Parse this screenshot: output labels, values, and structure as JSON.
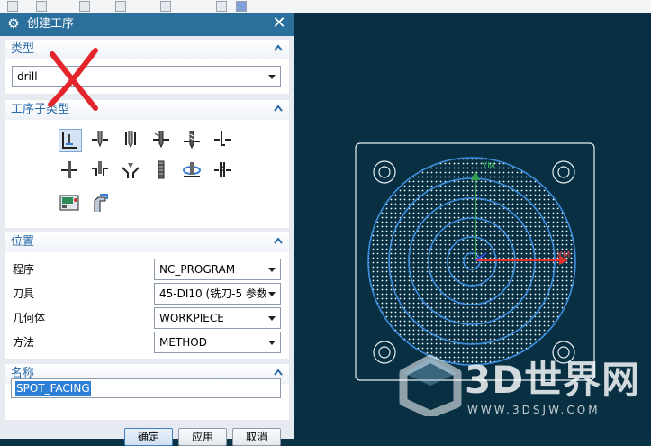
{
  "dialog": {
    "title": "创建工序",
    "close_glyph": "✕",
    "gear_glyph": "⚙"
  },
  "sections": {
    "type": {
      "label": "类型",
      "value": "drill"
    },
    "subtype": {
      "label": "工序子类型",
      "icons": [
        "spot-facing-icon",
        "spot-drilling-icon",
        "drilling-icon",
        "peck-drilling-icon",
        "breakchip-drilling-icon",
        "boring-icon",
        "reaming-icon",
        "counterboring-icon",
        "countersinking-icon",
        "tapping-icon",
        "hole-milling-icon",
        "thread-milling-icon",
        "mill-control-icon",
        "mill-user-icon"
      ]
    },
    "location": {
      "label": "位置",
      "rows": [
        {
          "label": "程序",
          "value": "NC_PROGRAM"
        },
        {
          "label": "刀具",
          "value": "45-DI10 (铣刀-5 参数"
        },
        {
          "label": "几何体",
          "value": "WORKPIECE"
        },
        {
          "label": "方法",
          "value": "METHOD"
        }
      ]
    },
    "name": {
      "label": "名称",
      "value": "SPOT_FACING"
    }
  },
  "buttons": {
    "ok": "确定",
    "apply": "应用",
    "cancel": "取消"
  },
  "viewport": {
    "axis_labels": {
      "y": "YM",
      "x": "XM"
    },
    "watermark": {
      "brand": "3D世界网",
      "url": "WWW.3DSJW.COM"
    }
  },
  "colors": {
    "titlebar": "#2b6f9d",
    "section_label": "#2b6ca8",
    "viewport_bg": "#083042",
    "annotation_mark": "#e3262b",
    "x_axis": "#e0312c",
    "y_axis": "#2fa24a",
    "z_axis": "#2f48d6"
  }
}
